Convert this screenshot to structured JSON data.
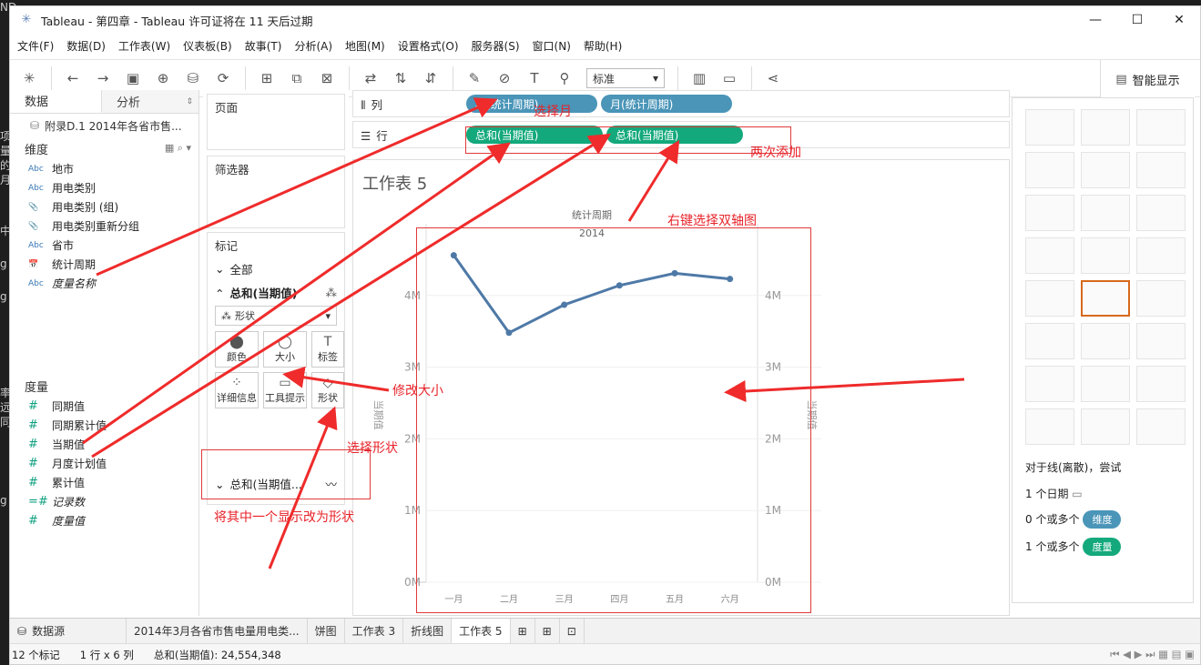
{
  "window": {
    "title": "Tableau - 第四章 - Tableau 许可证将在 11 天后过期",
    "controls": [
      "—",
      "☐",
      "✕"
    ]
  },
  "backdrop": [
    "ND",
    "项",
    "量",
    "的",
    "月",
    "中",
    "g",
    "g",
    "率",
    "远",
    "同",
    "g"
  ],
  "menu": [
    "文件(F)",
    "数据(D)",
    "工作表(W)",
    "仪表板(B)",
    "故事(T)",
    "分析(A)",
    "地图(M)",
    "设置格式(O)",
    "服务器(S)",
    "窗口(N)",
    "帮助(H)"
  ],
  "toolbar": {
    "fit_select": "标准",
    "show_me_label": "智能显示"
  },
  "data_pane": {
    "tab_data": "数据",
    "tab_analytics": "分析",
    "datasource": "附录D.1 2014年各省市售...",
    "dimensions_header": "维度",
    "dimensions": [
      {
        "icon": "Abc",
        "label": "地市"
      },
      {
        "icon": "Abc",
        "label": "用电类别"
      },
      {
        "icon": "📎",
        "label": "用电类别 (组)"
      },
      {
        "icon": "📎",
        "label": "用电类别重新分组"
      },
      {
        "icon": "Abc",
        "label": "省市"
      },
      {
        "icon": "📅",
        "label": "统计周期"
      },
      {
        "icon": "Abc",
        "label": "度量名称"
      }
    ],
    "measures_header": "度量",
    "measures": [
      {
        "icon": "#",
        "label": "同期值"
      },
      {
        "icon": "#",
        "label": "同期累计值"
      },
      {
        "icon": "#",
        "label": "当期值"
      },
      {
        "icon": "#",
        "label": "月度计划值"
      },
      {
        "icon": "#",
        "label": "累计值"
      },
      {
        "icon": "=#",
        "label": "记录数"
      },
      {
        "icon": "#",
        "label": "度量值"
      }
    ]
  },
  "cards": {
    "pages": "页面",
    "filters": "筛选器",
    "marks": "标记",
    "marks_all": "全部",
    "marks_sum1": "总和(当期值)",
    "mark_type": "形状",
    "mark_buttons": [
      {
        "icon": "⬤",
        "label": "颜色"
      },
      {
        "icon": "◯",
        "label": "大小"
      },
      {
        "icon": "T",
        "label": "标签"
      },
      {
        "icon": "⁘",
        "label": "详细信息"
      },
      {
        "icon": "▭",
        "label": "工具提示"
      },
      {
        "icon": "◇",
        "label": "形状"
      }
    ],
    "marks_sum2": "总和(当期值..."
  },
  "shelves": {
    "columns_label": "列",
    "rows_label": "行",
    "col_pills": [
      "年(统计周期)",
      "月(统计周期)"
    ],
    "row_pills": [
      "总和(当期值)",
      "总和(当期值)"
    ]
  },
  "sheet": {
    "title": "工作表 5",
    "header_field": "统计周期",
    "header_value": "2014",
    "left_axis_label": "当期值",
    "right_axis_label": "当期值"
  },
  "chart_data": {
    "type": "line",
    "categories": [
      "一月",
      "二月",
      "三月",
      "四月",
      "五月",
      "六月"
    ],
    "series": [
      {
        "values": [
          4.56,
          3.48,
          3.87,
          4.14,
          4.31,
          4.23
        ]
      }
    ],
    "ylim": [
      0,
      5
    ],
    "yticks": [
      "0M",
      "1M",
      "2M",
      "3M",
      "4M"
    ],
    "line_color": "#4e79a7"
  },
  "show_me": {
    "hint": "对于线(离散)，尝试",
    "line1": "1 个日期",
    "line2": "0 个或多个",
    "badge2": "维度",
    "line3": "1 个或多个",
    "badge3": "度量"
  },
  "tabs": [
    "数据源",
    "2014年3月各省市售电量用电类...",
    "饼图",
    "工作表 3",
    "折线图",
    "工作表 5"
  ],
  "status": {
    "marks": "12 个标记",
    "dims": "1 行 x 6 列",
    "sum": "总和(当期值): 24,554,348"
  },
  "annotations": {
    "a1": "选择月",
    "a2": "两次添加",
    "a3": "右键选择双轴图",
    "a4": "修改大小",
    "a5": "选择形状",
    "a6": "将其中一个显示改为形状"
  }
}
